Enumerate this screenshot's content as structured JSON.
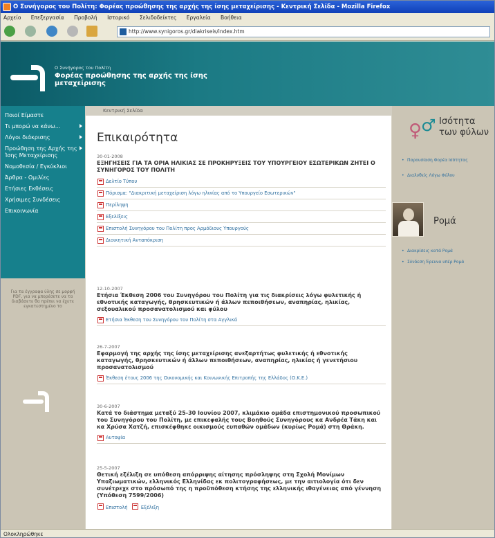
{
  "browser": {
    "title": "Ο Συνήγορος του Πολίτη: Φορέας προώθησης της αρχής της ίσης μεταχείρισης - Κεντρική Σελίδα - Mozilla Firefox",
    "menu": [
      "Αρχείο",
      "Επεξεργασία",
      "Προβολή",
      "Ιστορικό",
      "Σελιδοδείκτες",
      "Εργαλεία",
      "Βοήθεια"
    ],
    "url": "http://www.synigoros.gr/diakriseis/index.htm",
    "status": "Ολοκληρώθηκε"
  },
  "site": {
    "org_line1": "Ο Συνήγορος του Πολίτη",
    "org_line2": "Φορέας προώθησης της αρχής της ίσης μεταχείρισης",
    "breadcrumb": "Κεντρική Σελίδα"
  },
  "nav": {
    "items": [
      {
        "label": "Ποιοί Είμαστε",
        "arrow": false
      },
      {
        "label": "Τι μπορώ να κάνω...",
        "arrow": true
      },
      {
        "label": "Λόγοι διάκρισης",
        "arrow": true
      },
      {
        "label": "Προώθηση της Αρχής της Ίσης Μεταχείρισης",
        "arrow": true
      },
      {
        "label": "Νομοθεσία / Εγκύκλιοι",
        "arrow": false
      },
      {
        "label": "Άρθρα - Ομιλίες",
        "arrow": false
      },
      {
        "label": "Ετήσιες Εκθέσεις",
        "arrow": false
      },
      {
        "label": "Χρήσιμες Συνδέσεις",
        "arrow": false
      },
      {
        "label": "Επικοινωνία",
        "arrow": false
      }
    ],
    "pdf_note": "Για τα έγγραφα ύλης σε μορφή PDF, για να μπορέσετε να τα διαβάσετε θα πρέπει να έχετε εγκατεστημένο το"
  },
  "main": {
    "title": "Επικαιρότητα",
    "news": [
      {
        "date": "30-01-2008",
        "headline": "ΕΞΗΓΗΣΕΙΣ ΓΙΑ ΤΑ ΟΡΙΑ ΗΛΙΚΙΑΣ ΣΕ ΠΡΟΚΗΡΥΞΕΙΣ ΤΟΥ ΥΠΟΥΡΓΕΙΟΥ ΕΣΩΤΕΡΙΚΩΝ ΖΗΤΕΙ Ο ΣΥΝΗΓΟΡΟΣ ΤΟΥ ΠΟΛΙΤΗ",
        "docs": [
          "Δελτίο Τύπου",
          "Πόρισμα: \"Διακριτική μεταχείριση λόγω ηλικίας από το Υπουργείο Εσωτερικών\"",
          "Περίληψη",
          "Εξελίξεις",
          "Επιστολή Συνηγόρου του Πολίτη προς Αρμόδιους Υπουργούς",
          "Διοικητική Ανταπόκριση"
        ]
      },
      {
        "date": "12-10-2007",
        "headline": "Ετήσια Έκθεση 2006 του Συνηγόρου του Πολίτη για τις διακρίσεις λόγω φυλετικής ή εθνοτικής καταγωγής, θρησκευτικών ή άλλων πεποιθήσεων, αναπηρίας, ηλικίας, σεξουαλικού προσανατολισμού και φύλου",
        "docs": [
          "Ετήσια Έκθεση του Συνηγόρου του Πολίτη στα Αγγλικά"
        ]
      },
      {
        "date": "26-7-2007",
        "headline": "Εφαρμογή της αρχής της ίσης μεταχείρισης ανεξαρτήτως φυλετικής ή εθνοτικής καταγωγής, θρησκευτικών ή άλλων πεποιθήσεων, αναπηρίας, ηλικίας ή γενετήσιου προσανατολισμού",
        "docs": [
          "Έκθεση έτους 2006 της Οικονομικής και Κοινωνικής Επιτροπής της Ελλάδος (Ο.Κ.Ε.)"
        ]
      },
      {
        "date": "30-6-2007",
        "headline": "Κατά το διάστημα μεταξύ 25-30 Ιουνίου 2007, κλιμάκιο ομάδα επιστημονικού προσωπικού του Συνηγόρου του Πολίτη, με επικεφαλής τους Βοηθούς Συνηγόρους κα Ανδρέα Τάκη και κα Χρύσα Χατζή, επισκέφθηκε οικισμούς ευπαθών ομάδων (κυρίως Ρομά) στη Θράκη.",
        "docs": [
          "Αυτοψία"
        ]
      },
      {
        "date": "25-5-2007",
        "headline": "Θετική εξέλιξη σε υπόθεση απόρριψης αίτησης πρόσληψης στη Σχολή Μονίμων Υπαξιωματικών, ελληνικός Ελληνίδας εκ πολιτογραφήσεως, με την αιτιολογία ότι δεν συνέτρεχε στο πρόσωπό της η προϋπόθεση κτήσης της ελληνικής ιθαγένειας από γέννηση (Υπόθεση 7599/2006)",
        "docs": [
          "Επιστολή",
          "Εξέλιξη"
        ]
      }
    ]
  },
  "sidebar": {
    "equality_title": "Ισότητα των φύλων",
    "equality_links": [
      "Παρουσίαση Φορέα Ισότητας",
      "Διαλυθείς Λόγω Φύλου"
    ],
    "roma_title": "Ρομά",
    "roma_links": [
      "Διακρίσεις κατά Ρομά",
      "Σύνδεση Έρευνα υπέρ Ρομά"
    ]
  }
}
